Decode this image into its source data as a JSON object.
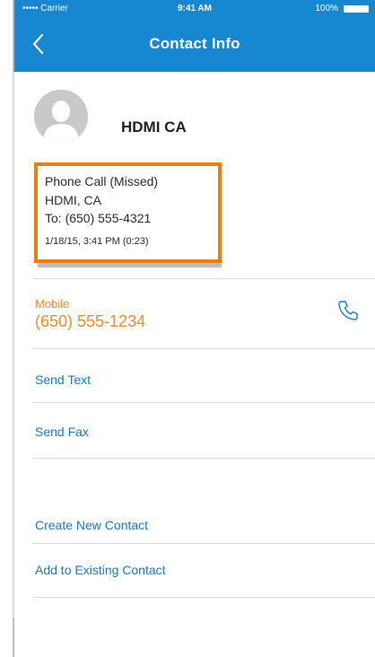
{
  "status_bar": {
    "carrier": "••••• Carrier",
    "time": "9:41 AM",
    "battery": "100%"
  },
  "nav": {
    "title": "Contact Info"
  },
  "contact": {
    "name": "HDMI CA"
  },
  "call_card": {
    "type": "Phone Call (Missed)",
    "location": "HDMI, CA",
    "to": "To: (650) 555-4321",
    "datetime": "1/18/15, 3:41 PM (0:23)",
    "highlight_color": "#f07d10"
  },
  "mobile": {
    "label": "Mobile",
    "number": "(650) 555-1234"
  },
  "actions": {
    "send_text": "Send Text",
    "send_fax": "Send Fax",
    "create_new_contact": "Create New Contact",
    "add_to_existing_contact": "Add to Existing Contact"
  },
  "colors": {
    "header_blue": "#1887d2",
    "link_blue": "#1a79c7",
    "accent_orange": "#f28c28"
  }
}
